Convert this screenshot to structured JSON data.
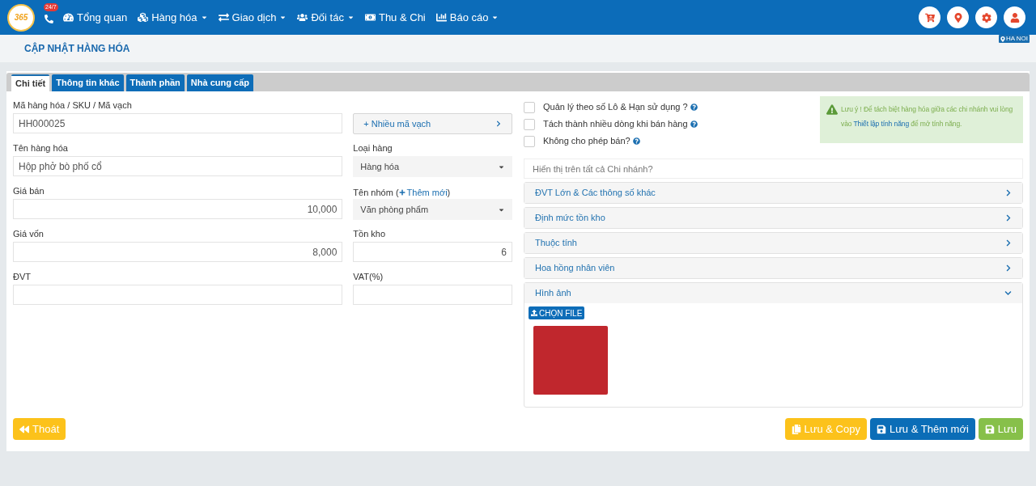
{
  "navbar": {
    "logo_text": "365",
    "support_badge": "24/7",
    "menu": [
      {
        "label": "Tổng quan",
        "has_dropdown": false
      },
      {
        "label": "Hàng hóa",
        "has_dropdown": true
      },
      {
        "label": "Giao dịch",
        "has_dropdown": true
      },
      {
        "label": "Đối tác",
        "has_dropdown": true
      },
      {
        "label": "Thu & Chi",
        "has_dropdown": false
      },
      {
        "label": "Báo cáo",
        "has_dropdown": true
      }
    ]
  },
  "branch_badge": "HA NOI",
  "page_title": "CẬP NHẬT HÀNG HÓA",
  "tabs": [
    {
      "label": "Chi tiết",
      "selected": true
    },
    {
      "label": "Thông tin khác",
      "selected": false
    },
    {
      "label": "Thành phần",
      "selected": false
    },
    {
      "label": "Nhà cung cấp",
      "selected": false
    }
  ],
  "left_fields": [
    {
      "label": "Mã hàng hóa / SKU / Mã vạch",
      "value": "HH000025",
      "kind": "text"
    },
    {
      "label": "Tên hàng hóa",
      "value": "Hộp phở bò phố cổ",
      "kind": "text"
    },
    {
      "label": "Giá bán",
      "value": "10,000",
      "kind": "number"
    },
    {
      "label": "Giá vốn",
      "value": "8,000",
      "kind": "number"
    },
    {
      "label": "ĐVT",
      "kind": "text"
    }
  ],
  "middle_fields": [
    {
      "kind": "button",
      "label": "+ Nhiều mã vạch"
    },
    {
      "kind": "select",
      "label": "Loại hàng",
      "value": "Hàng hóa"
    },
    {
      "kind": "select",
      "label": "Tên nhóm (",
      "link": "Thêm mới",
      "label_suffix": ")",
      "value": "Văn phòng phẩm"
    },
    {
      "kind": "number",
      "label": "Tồn kho",
      "value": "6"
    },
    {
      "kind": "text",
      "label": "VAT(%)"
    }
  ],
  "checkboxes": [
    {
      "label": "Quản lý theo số Lô & Hạn sử dụng ?",
      "checked": false
    },
    {
      "label": "Tách thành nhiều dòng khi bán hàng",
      "checked": false
    },
    {
      "label": "Không cho phép bán?",
      "checked": false
    }
  ],
  "alert": {
    "prefix": "Lưu ý ! Để tách biệt hàng hóa giữa các chi nhánh vui lòng vào ",
    "link": "Thiết lập tính năng",
    "suffix": " để mở tính năng."
  },
  "branch_field": {
    "placeholder": "Hiển thị trên tất cả Chi nhánh?"
  },
  "sections": [
    {
      "title": "ĐVT Lớn & Các thông số khác",
      "expanded": false
    },
    {
      "title": "Định mức tồn kho",
      "expanded": false
    },
    {
      "title": "Thuộc tính",
      "expanded": false
    },
    {
      "title": "Hoa hồng nhân viên",
      "expanded": false
    },
    {
      "title": "Hình ảnh",
      "expanded": true,
      "upload_button": "CHỌN FILE"
    }
  ],
  "footer_buttons": [
    {
      "label": "Thoát",
      "kind": "exit"
    },
    {
      "label": "Lưu & Copy",
      "kind": "copy"
    },
    {
      "label": "Lưu & Thêm mới",
      "kind": "save_new"
    },
    {
      "label": "Lưu",
      "kind": "save"
    }
  ]
}
